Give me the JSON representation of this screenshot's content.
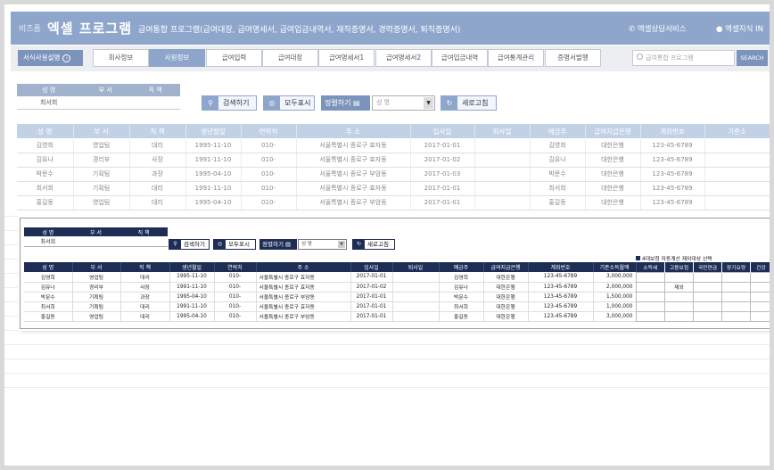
{
  "header": {
    "brand": "비즈폼",
    "title": "엑셀 프로그램",
    "subtitle": "급여통합 프로그램(급여대장, 급여명세서, 급여입금내역서, 재직증명서, 경력증명서, 퇴직증명서)",
    "service": "엑셀상담서비스",
    "knowledge": "엑셀지식 IN"
  },
  "nav": {
    "guide": "서식사용설명",
    "tabs": [
      "회사정보",
      "사원정보",
      "급여입력",
      "급여대장",
      "급여명세서1",
      "급여명세서2",
      "급여입금내역",
      "급여통계관리",
      "증명서발행"
    ],
    "active_tab": 1,
    "search_placeholder": "급여통합 프로그램",
    "search_btn": "SEARCH"
  },
  "filter": {
    "headers": [
      "성 명",
      "부 서",
      "직 책"
    ],
    "values": [
      "최서희",
      "",
      ""
    ],
    "search": "검색하기",
    "show_all": "모두표시",
    "sort_label": "정렬하기",
    "sort_value": "성 명",
    "refresh": "새로고침"
  },
  "grid": {
    "headers": [
      "성 명",
      "부 서",
      "직 책",
      "생년월일",
      "연락처",
      "주 소",
      "입사일",
      "퇴사일",
      "예금주",
      "급여지급은행",
      "계좌번호",
      "기준소"
    ],
    "rows": [
      [
        "김영희",
        "영업팀",
        "대리",
        "1995-11-10",
        "010-",
        "서울특별시 종로구 효자동",
        "2017-01-01",
        "",
        "김영희",
        "대한은행",
        "123-45-6789",
        ""
      ],
      [
        "김유나",
        "경리부",
        "사장",
        "1991-11-10",
        "010-",
        "서울특별시 종로구 효자동",
        "2017-01-02",
        "",
        "김유나",
        "대한은행",
        "123-45-6789",
        ""
      ],
      [
        "박문수",
        "기획팀",
        "과장",
        "1995-04-10",
        "010-",
        "서울특별시 종로구 부암동",
        "2017-01-03",
        "",
        "박문수",
        "대한은행",
        "123-45-6789",
        ""
      ],
      [
        "최서희",
        "기획팀",
        "대리",
        "1991-11-10",
        "010-",
        "서울특별시 종로구 효자동",
        "2017-01-01",
        "",
        "최서희",
        "대한은행",
        "123-45-6789",
        ""
      ],
      [
        "홍길동",
        "영업팀",
        "대리",
        "1995-04-10",
        "010-",
        "서울특별시 종로구 부암동",
        "2017-01-01",
        "",
        "홍길동",
        "대한은행",
        "123-45-6789",
        ""
      ]
    ]
  },
  "inner": {
    "filter_values": [
      "최서희",
      "",
      ""
    ],
    "headers": [
      "성 명",
      "부 서",
      "직 책",
      "생년월일",
      "연락처",
      "주 소",
      "입사일",
      "퇴사일",
      "예금주",
      "급여지급은행",
      "계좌번호",
      "기준소득월액"
    ],
    "rows": [
      [
        "김영희",
        "영업팀",
        "대리",
        "1995-11-10",
        "010-",
        "서울특별시 종로구 효자동",
        "2017-01-01",
        "",
        "김영희",
        "대한은행",
        "123-45-6789",
        "3,000,000"
      ],
      [
        "김유나",
        "경리부",
        "사장",
        "1991-11-10",
        "010-",
        "서울특별시 종로구 효자동",
        "2017-01-02",
        "",
        "김유나",
        "대한은행",
        "123-45-6789",
        "2,000,000"
      ],
      [
        "박문수",
        "기획팀",
        "과장",
        "1995-04-10",
        "010-",
        "서울특별시 종로구 부암동",
        "2017-01-01",
        "",
        "박문수",
        "대한은행",
        "123-45-6789",
        "1,500,000"
      ],
      [
        "최서희",
        "기획팀",
        "대리",
        "1991-11-10",
        "010-",
        "서울특별시 종로구 효자동",
        "2017-01-01",
        "",
        "최서희",
        "대한은행",
        "123-45-6789",
        "1,000,000"
      ],
      [
        "홍길동",
        "영업팀",
        "대리",
        "1995-04-10",
        "010-",
        "서울특별시 종로구 부암동",
        "2017-01-01",
        "",
        "홍길동",
        "대한은행",
        "123-45-6789",
        "3,000,000"
      ]
    ],
    "insurance_note": "4대보험 자동계산 제외대상 선택",
    "insurance_headers": [
      "소득세",
      "고용보험",
      "국민연금",
      "장기요양",
      "건강"
    ],
    "insurance_rows": [
      [
        "",
        "",
        "",
        "",
        ""
      ],
      [
        "",
        "제외",
        "",
        "",
        ""
      ],
      [
        "",
        "",
        "",
        "",
        ""
      ],
      [
        "",
        "",
        "",
        "",
        ""
      ],
      [
        "",
        "",
        "",
        "",
        ""
      ]
    ]
  },
  "colors": {
    "header": "#8ea6cc",
    "accent": "#7c94bc",
    "navy": "#1e2d56"
  }
}
